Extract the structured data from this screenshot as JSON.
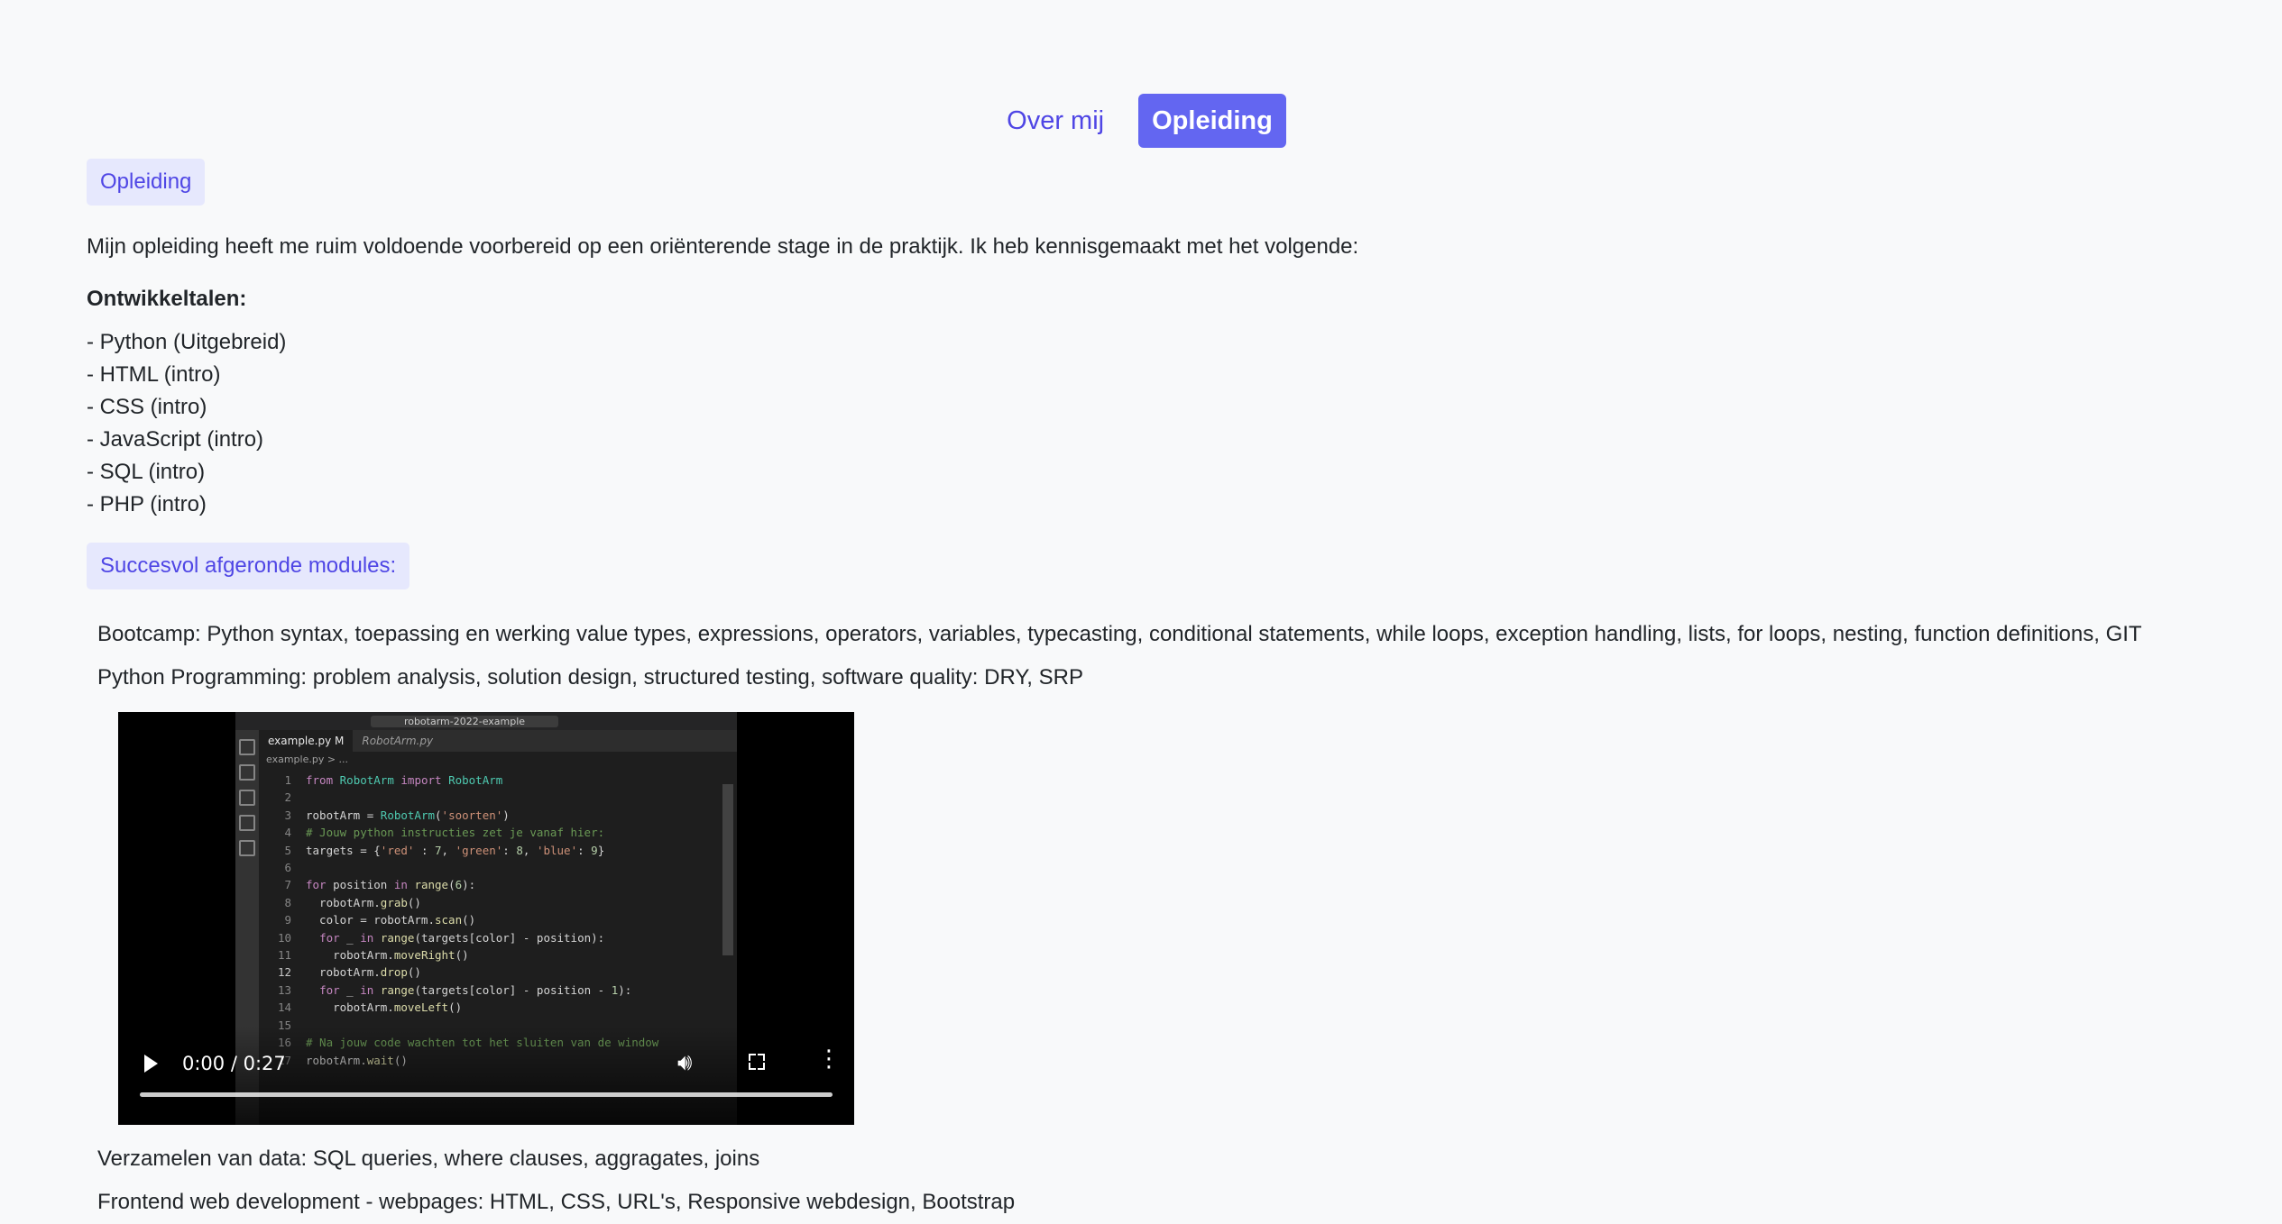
{
  "nav": {
    "items": [
      "Over mij",
      "Opleiding"
    ],
    "active": "Opleiding"
  },
  "section": {
    "badge": "Opleiding",
    "intro": "Mijn opleiding heeft me ruim voldoende voorbereid op een oriënterende stage in de praktijk. Ik heb kennisgemaakt met het volgende:",
    "languages_heading": "Ontwikkeltalen:",
    "languages": [
      "- Python (Uitgebreid)",
      "- HTML (intro)",
      "- CSS (intro)",
      "- JavaScript (intro)",
      "- SQL (intro)",
      "- PHP (intro)"
    ],
    "modules_badge": "Succesvol afgeronde modules:",
    "modules_before_video": [
      "Bootcamp: Python syntax, toepassing en werking value types, expressions, operators, variables, typecasting, conditional statements, while loops, exception handling, lists, for loops, nesting, function definitions, GIT",
      "Python Programming: problem analysis, solution design, structured testing, software quality: DRY, SRP"
    ],
    "modules_after_video": [
      "Verzamelen van data: SQL queries, where clauses, aggragates, joins",
      "Frontend web development - webpages: HTML, CSS, URL's, Responsive webdesign, Bootstrap"
    ]
  },
  "video": {
    "time": "0:00 / 0:27",
    "progress": 0,
    "editor": {
      "search": "robotarm-2022-example",
      "tabs": [
        "example.py M",
        "RobotArm.py"
      ],
      "breadcrumb": "example.py > ...",
      "lines": [
        {
          "n": "1",
          "t": "from RobotArm import RobotArm"
        },
        {
          "n": "2",
          "t": ""
        },
        {
          "n": "3",
          "t": "robotArm = RobotArm('soorten')"
        },
        {
          "n": "4",
          "t": "# Jouw python instructies zet je vanaf hier:"
        },
        {
          "n": "5",
          "t": "targets = {'red' : 7, 'green': 8, 'blue': 9}"
        },
        {
          "n": "6",
          "t": ""
        },
        {
          "n": "7",
          "t": "for position in range(6):"
        },
        {
          "n": "8",
          "t": "  robotArm.grab()"
        },
        {
          "n": "9",
          "t": "  color = robotArm.scan()"
        },
        {
          "n": "10",
          "t": "  for _ in range(targets[color] - position):"
        },
        {
          "n": "11",
          "t": "    robotArm.moveRight()"
        },
        {
          "n": "12",
          "t": "  robotArm.drop()"
        },
        {
          "n": "13",
          "t": "  for _ in range(targets[color] - position - 1):"
        },
        {
          "n": "14",
          "t": "    robotArm.moveLeft()"
        },
        {
          "n": "15",
          "t": ""
        },
        {
          "n": "16",
          "t": "# Na jouw code wachten tot het sluiten van de window"
        },
        {
          "n": "17",
          "t": "robotArm.wait()"
        }
      ]
    }
  },
  "colors": {
    "accent": "#6366f1",
    "badge_bg": "#e6e8fd",
    "link": "#4f46e5"
  },
  "icons": [
    "play-icon",
    "volume-icon",
    "fullscreen-icon",
    "more-vert-icon"
  ]
}
